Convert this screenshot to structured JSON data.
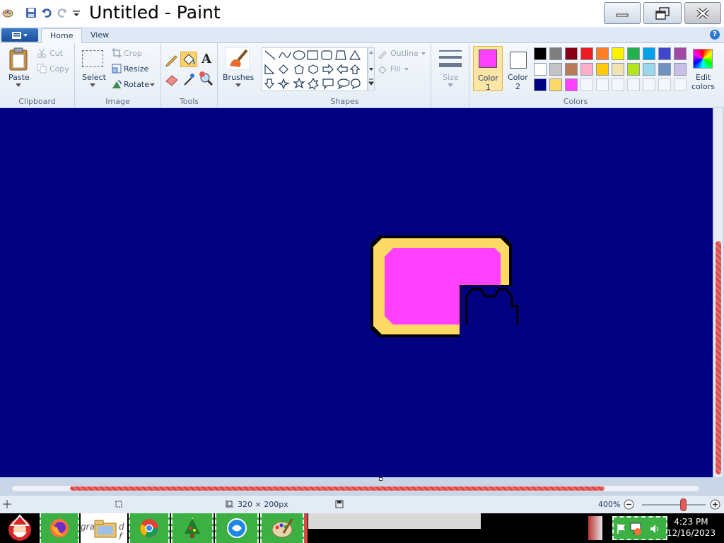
{
  "window": {
    "title": "Untitled - Paint"
  },
  "tabs": {
    "home": "Home",
    "view": "View"
  },
  "clipboard": {
    "paste": "Paste",
    "cut": "Cut",
    "copy": "Copy",
    "group_label": "Clipboard"
  },
  "image": {
    "select": "Select",
    "crop": "Crop",
    "resize": "Resize",
    "rotate": "Rotate",
    "group_label": "Image"
  },
  "tools": {
    "group_label": "Tools"
  },
  "brushes": {
    "label": "Brushes"
  },
  "shapes": {
    "outline": "Outline",
    "fill": "Fill",
    "group_label": "Shapes"
  },
  "size": {
    "label": "Size"
  },
  "colors": {
    "color1_label": "Color",
    "color1_num": "1",
    "color2_label": "Color",
    "color2_num": "2",
    "edit_label": "Edit",
    "edit_label2": "colors",
    "group_label": "Colors",
    "color1_value": "#ff40ff",
    "color2_value": "#ffffff",
    "palette_row1": [
      "#000000",
      "#7f7f7f",
      "#880015",
      "#ed1c24",
      "#ff7f27",
      "#fff200",
      "#22b14c",
      "#00a2e8",
      "#3f48cc",
      "#a349a4"
    ],
    "palette_row2": [
      "#ffffff",
      "#c3c3c3",
      "#b97a57",
      "#ffaec9",
      "#ffc90e",
      "#efe4b0",
      "#b5e61d",
      "#99d9ea",
      "#7092be",
      "#c8bfe7"
    ],
    "palette_row3": [
      "#000080",
      "#ffd966",
      "#ff40ff"
    ]
  },
  "canvas": {
    "background": "#000080"
  },
  "status": {
    "dimensions": "320 × 200px",
    "zoom": "400%"
  },
  "taskbar": {
    "task2_text": "gra",
    "task2_text_b": "d f",
    "time": "4:23 PM",
    "date": "12/16/2023"
  }
}
